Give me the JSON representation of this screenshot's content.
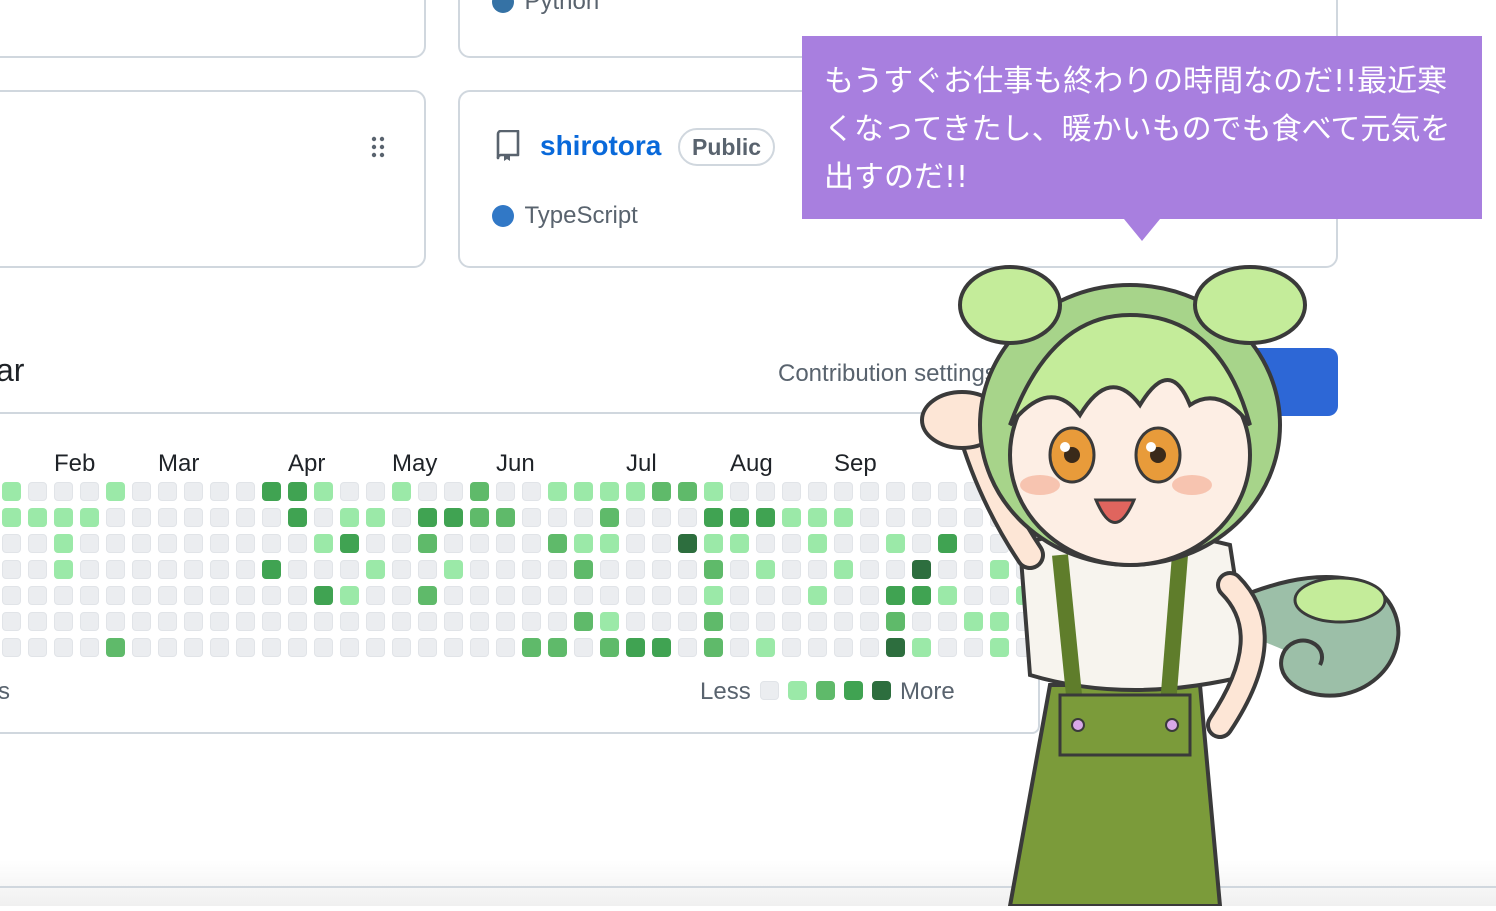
{
  "cards": {
    "top_right_lang": "Python",
    "repo": {
      "name": "shirotora",
      "visibility": "Public",
      "language": "TypeScript",
      "python_color": "#3572A5",
      "typescript_color": "#3178c6"
    }
  },
  "contributions": {
    "title_fragment": "ar",
    "settings_label": "Contribution settings",
    "months": [
      "Feb",
      "Mar",
      "Apr",
      "May",
      "Jun",
      "Jul",
      "Aug",
      "Sep"
    ],
    "footer_fragment": "s",
    "legend_less": "Less",
    "legend_more": "More",
    "levels_colors": [
      "#ebedf0",
      "#9be9a8",
      "#5fba6a",
      "#40a352",
      "#2d6e3e"
    ],
    "grid": [
      "1000100000331001002001111221000000000000120",
      "1111000000030110332200020003331110000000040",
      "0010000000001300200002110041100100103000300",
      "0010000000300010010000200002010010040010140",
      "0000000000003100200000000001000100331001000",
      "0000000000000000000000210002000000200110000",
      "0000200000000000000022023302010000410010200"
    ]
  },
  "speech": {
    "text": "もうすぐお仕事も終わりの時間なのだ!!最近寒くなってきたし、暖かいものでも食べて元気を出すのだ!!"
  },
  "assets": {
    "accent_button_color": "#2d67d6",
    "bubble_color": "#a87fdf"
  }
}
